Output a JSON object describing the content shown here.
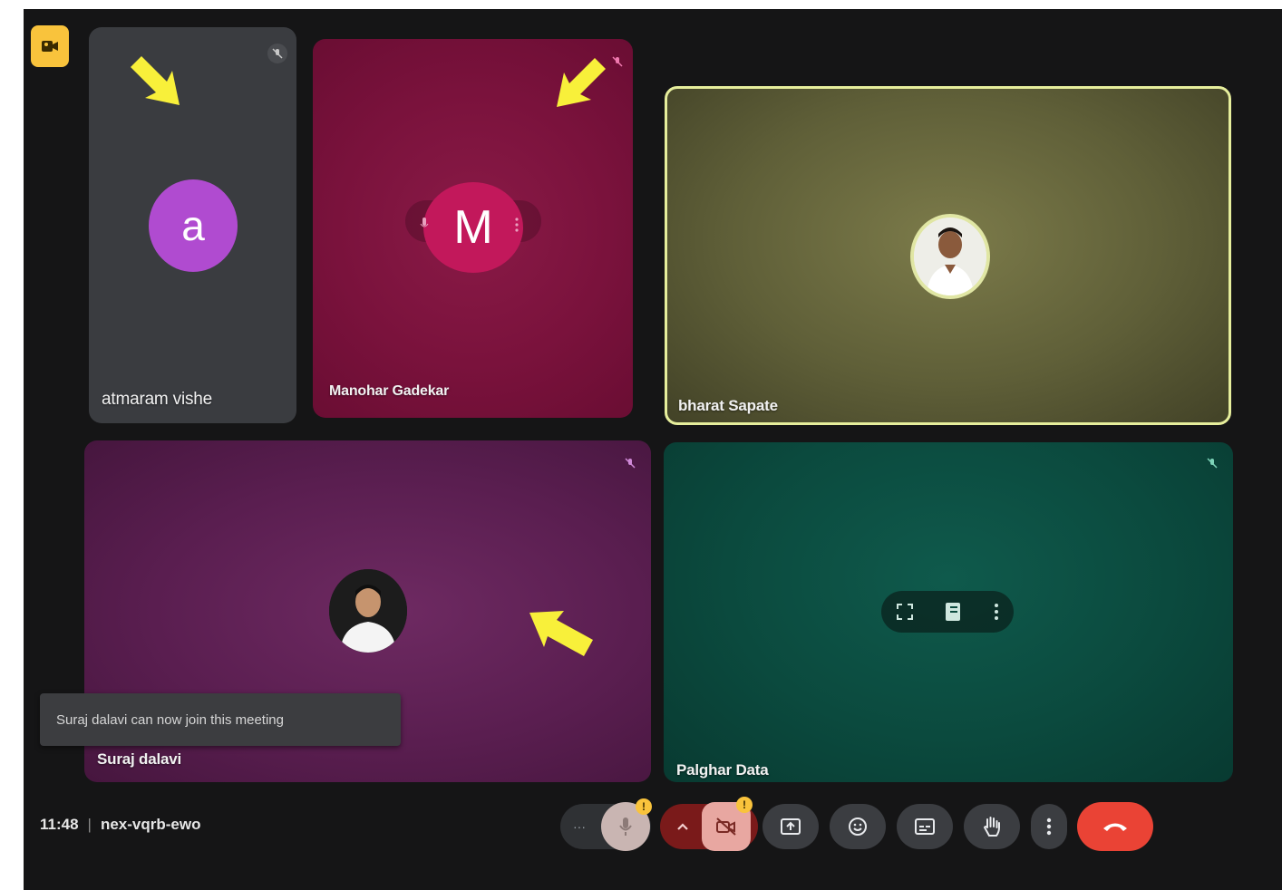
{
  "participants": [
    {
      "name": "atmaram vishe",
      "initial": "a"
    },
    {
      "name": "Manohar Gadekar",
      "initial": "M"
    },
    {
      "name": "bharat Sapate"
    },
    {
      "name": "Suraj dalavi"
    },
    {
      "name": "Palghar Data"
    }
  ],
  "toast": {
    "text": "Suraj dalavi can now join this meeting"
  },
  "footer": {
    "time": "11:48",
    "separator": "|",
    "meeting_code": "nex-vqrb-ewo"
  },
  "controls": {
    "more_dots": "···",
    "mic_badge": "!",
    "cam_badge": "!"
  },
  "icons": {
    "top_left": "people-video-icon",
    "muted": "mic-off-icon",
    "tile_menu": [
      "fullscreen-icon",
      "pin-icon",
      "more-vert-icon"
    ],
    "controls": [
      "more-options-icon",
      "mic-icon",
      "chevron-up-icon",
      "camera-off-icon",
      "present-icon",
      "emoji-icon",
      "captions-icon",
      "raise-hand-icon",
      "more-vert-icon",
      "end-call-icon"
    ]
  },
  "colors": {
    "background": "#151516",
    "avatar_a": "#b04bd0",
    "avatar_m": "#c2185b",
    "end_call": "#ea4335",
    "highlight": "#e6ee9c",
    "arrows": "#f8f03a"
  }
}
